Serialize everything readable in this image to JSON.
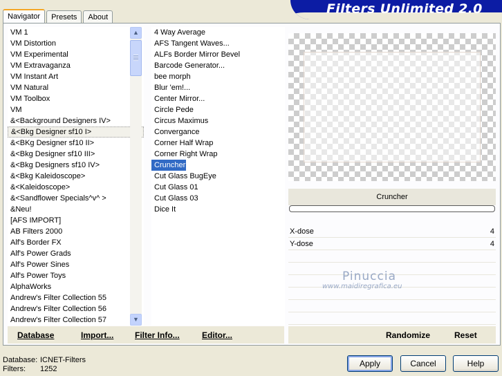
{
  "window": {
    "title": "Filters Unlimited 2.0"
  },
  "tabs": [
    {
      "label": "Navigator",
      "active": true
    },
    {
      "label": "Presets",
      "active": false
    },
    {
      "label": "About",
      "active": false
    }
  ],
  "categories": [
    "VM 1",
    "VM Distortion",
    "VM Experimental",
    "VM Extravaganza",
    "VM Instant Art",
    "VM Natural",
    "VM Toolbox",
    "VM",
    "&<Background Designers IV>",
    "&<Bkg Designer sf10 I>",
    "&<BKg Designer sf10 II>",
    "&<Bkg Designer sf10 III>",
    "&<Bkg Designers sf10 IV>",
    "&<Bkg Kaleidoscope>",
    "&<Kaleidoscope>",
    "&<Sandflower Specials^v^ >",
    "&Neu!",
    "[AFS IMPORT]",
    "AB Filters 2000",
    "Alf's Border FX",
    "Alf's Power Grads",
    "Alf's Power Sines",
    "Alf's Power Toys",
    "AlphaWorks",
    "Andrew's Filter Collection 55",
    "Andrew's Filter Collection 56",
    "Andrew's Filter Collection 57"
  ],
  "selected_category": "&<Bkg Designer sf10 I>",
  "filters": [
    "4 Way Average",
    "AFS Tangent Waves...",
    "ALFs Border Mirror Bevel",
    "Barcode Generator...",
    "bee morph",
    "Blur 'em!...",
    "Center Mirror...",
    "Circle Pede",
    "Circus Maximus",
    "Convergance",
    "Corner Half Wrap",
    "Corner Right Wrap",
    "Cruncher",
    "Cut Glass  BugEye",
    "Cut Glass 01",
    "Cut Glass 03",
    "Dice It"
  ],
  "selected_filter": "Cruncher",
  "preview": {
    "filter_name": "Cruncher"
  },
  "params": [
    {
      "name": "X-dose",
      "value": "4"
    },
    {
      "name": "Y-dose",
      "value": "4"
    }
  ],
  "watermark": {
    "line1": "Pinuccia",
    "line2": "www.maidiregrafica.eu"
  },
  "actions": {
    "database": "Database",
    "import": "Import...",
    "filter_info": "Filter Info...",
    "editor": "Editor...",
    "randomize": "Randomize",
    "reset": "Reset"
  },
  "status": {
    "database_label": "Database:",
    "database_value": "ICNET-Filters",
    "filters_label": "Filters:",
    "filters_value": "1252"
  },
  "buttons": {
    "apply": "Apply",
    "cancel": "Cancel",
    "help": "Help"
  },
  "colors": {
    "banner": "#0c1ca4",
    "selection": "#316ac5",
    "background": "#ece9d8"
  }
}
